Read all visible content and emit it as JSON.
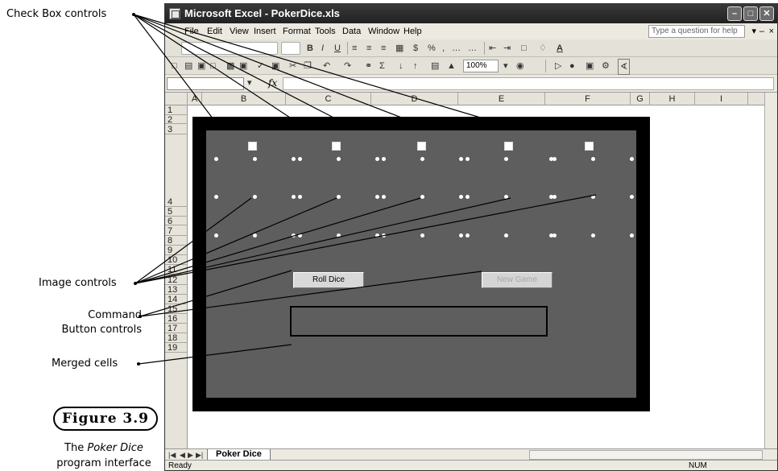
{
  "annotations": {
    "checkbox": "Check Box controls",
    "image": "Image controls",
    "command_line1": "Command",
    "command_line2": "Button controls",
    "merged": "Merged cells"
  },
  "figure": {
    "label": "Figure 3.9",
    "caption_pre": "The ",
    "caption_italic": "Poker Dice",
    "caption_post": " program interface"
  },
  "window": {
    "title": "Microsoft Excel - PokerDice.xls"
  },
  "menu": {
    "items": [
      "File",
      "Edit",
      "View",
      "Insert",
      "Format",
      "Tools",
      "Data",
      "Window",
      "Help"
    ],
    "help_placeholder": "Type a question for help"
  },
  "toolbar": {
    "zoom": "100%"
  },
  "formula": {
    "fx": "fx"
  },
  "grid": {
    "columns": [
      "A",
      "B",
      "C",
      "D",
      "E",
      "F",
      "G",
      "H",
      "I"
    ],
    "rows": [
      "1",
      "2",
      "3",
      "4",
      "5",
      "6",
      "7",
      "8",
      "9",
      "10",
      "11",
      "12",
      "13",
      "14",
      "15",
      "16",
      "17",
      "18",
      "19"
    ]
  },
  "buttons": {
    "roll": "Roll Dice",
    "new_game": "New Game"
  },
  "sheet": {
    "tab": "Poker Dice"
  },
  "status": {
    "ready": "Ready",
    "num": "NUM"
  },
  "colors": {
    "board": "#5e5e5e",
    "frame": "#000000",
    "titlebar": "#2e2e2e"
  }
}
